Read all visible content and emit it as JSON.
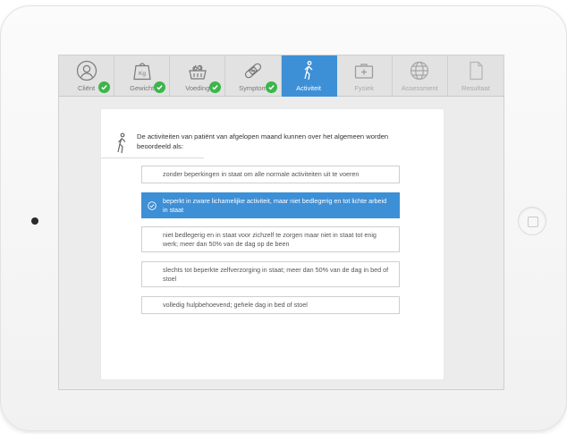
{
  "tabs": [
    {
      "label": "Cliënt",
      "icon": "person-icon",
      "completed": true,
      "active": false
    },
    {
      "label": "Gewicht",
      "icon": "weight-icon",
      "completed": true,
      "active": false
    },
    {
      "label": "Voeding",
      "icon": "food-basket-icon",
      "completed": true,
      "active": false
    },
    {
      "label": "Symptom",
      "icon": "bandage-icon",
      "completed": true,
      "active": false
    },
    {
      "label": "Activiteit",
      "icon": "walking-icon",
      "completed": false,
      "active": true
    },
    {
      "label": "Fysiek",
      "icon": "medical-kit-icon",
      "completed": false,
      "active": false
    },
    {
      "label": "Assessment",
      "icon": "globe-icon",
      "completed": false,
      "active": false
    },
    {
      "label": "Resultaat",
      "icon": "document-icon",
      "completed": false,
      "active": false
    }
  ],
  "question": {
    "icon": "walking-icon",
    "text": "De activiteiten van patiënt van afgelopen maand kunnen over het algemeen worden beoordeeld als:"
  },
  "options": [
    {
      "text": "zonder beperkingen in staat om alle normale activiteiten uit te voeren",
      "selected": false
    },
    {
      "text": "beperkt in zware lichamelijke activiteit, maar niet bedlegerig en tot lichte arbeid in staat",
      "selected": true
    },
    {
      "text": "niet bedlegerig en in staat voor zichzelf te zorgen maar niet in staat tot enig werk; meer dan 50% van de dag op de been",
      "selected": false
    },
    {
      "text": "slechts tot beperkte zelfverzorging in staat; meer dan 50% van de dag in bed of stoel",
      "selected": false
    },
    {
      "text": "volledig hulpbehoevend; gehele dag in bed of stoel",
      "selected": false
    }
  ],
  "colors": {
    "accent": "#3d8fd6",
    "check_green": "#3cb54a",
    "tab_bg": "#e2e2e2",
    "screen_bg": "#ececec"
  }
}
